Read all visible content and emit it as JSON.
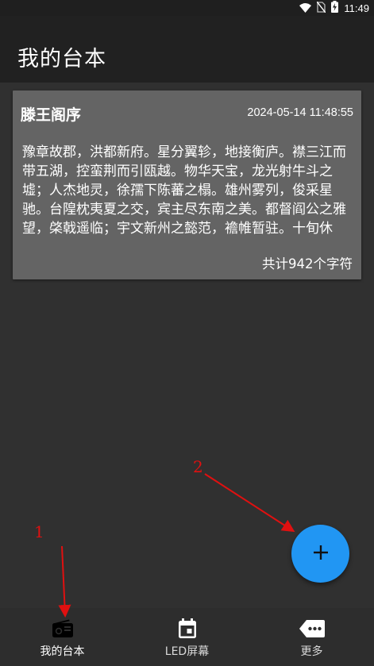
{
  "status_bar": {
    "time": "11:49",
    "icons": [
      "wifi-icon",
      "no-sim-icon",
      "battery-charging-icon"
    ]
  },
  "app_bar": {
    "title": "我的台本"
  },
  "scripts": [
    {
      "title": "滕王阁序",
      "timestamp": "2024-05-14 11:48:55",
      "preview": "豫章故郡，洪都新府。星分翼轸，地接衡庐。襟三江而带五湖，控蛮荆而引瓯越。物华天宝，龙光射牛斗之墟；人杰地灵，徐孺下陈蕃之榻。雄州雾列，俊采星驰。台隍枕夷夏之交，宾主尽东南之美。都督阎公之雅望，棨戟遥临；宇文新州之懿范，襜帷暂驻。十旬休假，胜友如云；千里逢迎，",
      "char_count": "共计942个字符"
    }
  ],
  "fab": {
    "icon": "plus-icon",
    "color": "#2196f3"
  },
  "bottom_nav": {
    "items": [
      {
        "label": "我的台本",
        "icon": "radio-icon",
        "active": true
      },
      {
        "label": "LED屏幕",
        "icon": "calendar-icon",
        "active": false
      },
      {
        "label": "更多",
        "icon": "more-tag-icon",
        "active": false
      }
    ]
  },
  "annotations": {
    "label_1": "1",
    "label_2": "2",
    "color": "#e01010"
  }
}
